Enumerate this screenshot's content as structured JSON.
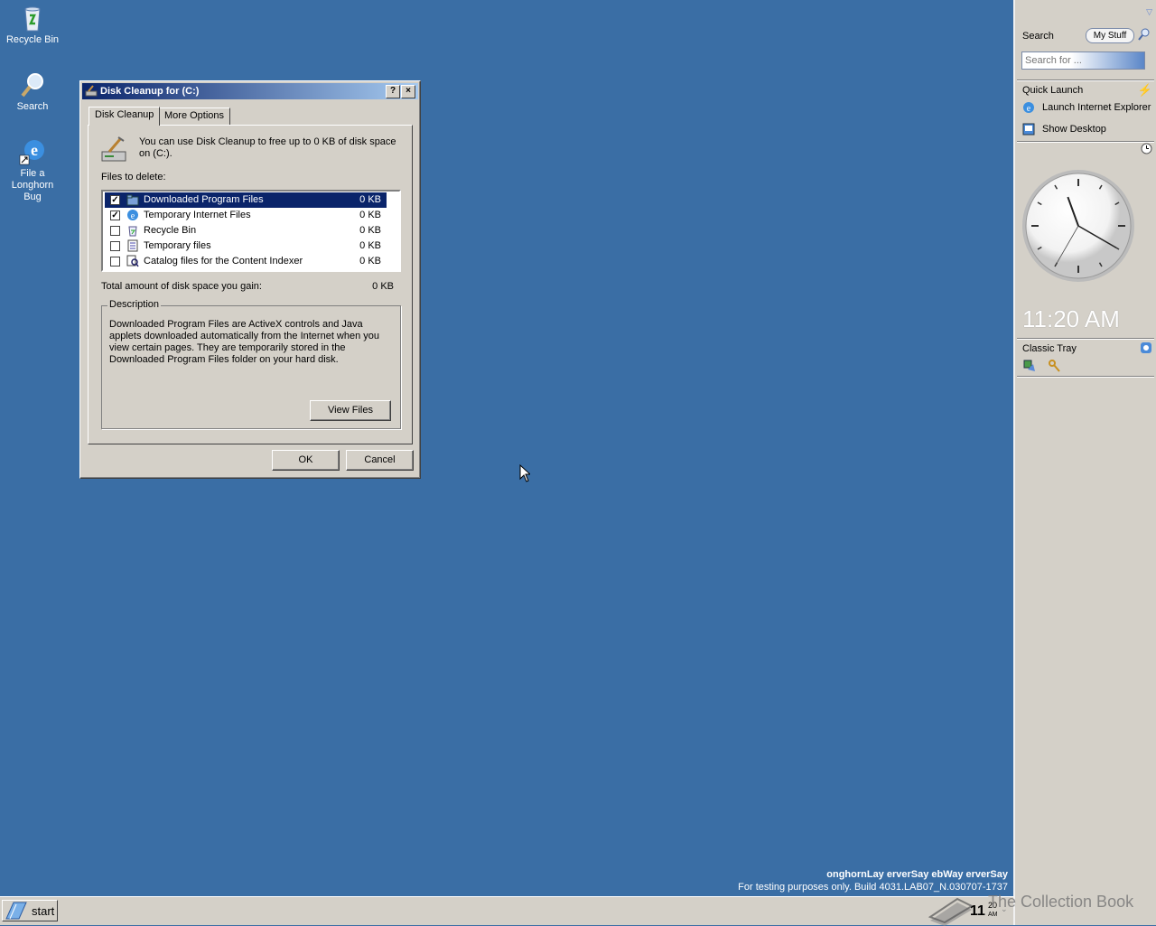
{
  "desktop": {
    "icons": [
      {
        "label": "Recycle Bin"
      },
      {
        "label": "Search"
      },
      {
        "label": "File a Longhorn Bug"
      }
    ]
  },
  "dialog": {
    "title": "Disk Cleanup for  (C:)",
    "help_btn": "?",
    "close_btn": "×",
    "tabs": [
      {
        "label": "Disk Cleanup"
      },
      {
        "label": "More Options"
      }
    ],
    "intro_text": "You can use Disk Cleanup to free up to 0 KB of disk space on  (C:).",
    "files_to_delete_label": "Files to delete:",
    "files": [
      {
        "name": "Downloaded Program Files",
        "size": "0 KB",
        "checked": true,
        "selected": true
      },
      {
        "name": "Temporary Internet Files",
        "size": "0 KB",
        "checked": true,
        "selected": false
      },
      {
        "name": "Recycle Bin",
        "size": "0 KB",
        "checked": false,
        "selected": false
      },
      {
        "name": "Temporary files",
        "size": "0 KB",
        "checked": false,
        "selected": false
      },
      {
        "name": "Catalog files for the Content Indexer",
        "size": "0 KB",
        "checked": false,
        "selected": false
      }
    ],
    "total_label": "Total amount of disk space you gain:",
    "total_value": "0 KB",
    "description_title": "Description",
    "description_text": "Downloaded Program Files are ActiveX controls and Java applets downloaded automatically from the Internet when you view certain pages. They are temporarily stored in the Downloaded Program Files folder on your hard disk.",
    "view_files_btn": "View Files",
    "ok_btn": "OK",
    "cancel_btn": "Cancel"
  },
  "sidebar": {
    "search_label": "Search",
    "my_stuff_btn": "My Stuff",
    "search_placeholder": "Search for ...",
    "quick_launch_label": "Quick Launch",
    "quick_launch_items": [
      {
        "label": "Launch Internet Explorer"
      },
      {
        "label": "Show Desktop"
      }
    ],
    "clock_time": "11:20 AM",
    "clock_hour": 11,
    "clock_minute": 20,
    "clock_second": 35,
    "classic_tray_label": "Classic Tray"
  },
  "watermark": {
    "line1": "onghornLay erverSay ebWay erverSay",
    "line2": "For testing purposes only. Build 4031.LAB07_N.030707-1737"
  },
  "taskbar": {
    "start_label": "start",
    "tray_time_hour": "11",
    "tray_time_min": "20",
    "tray_time_ampm": "AM",
    "collection_text": "The Collection Book"
  },
  "colors": {
    "desktop": "#3a6ea5",
    "selection": "#0a246a",
    "face": "#d4d0c8"
  }
}
